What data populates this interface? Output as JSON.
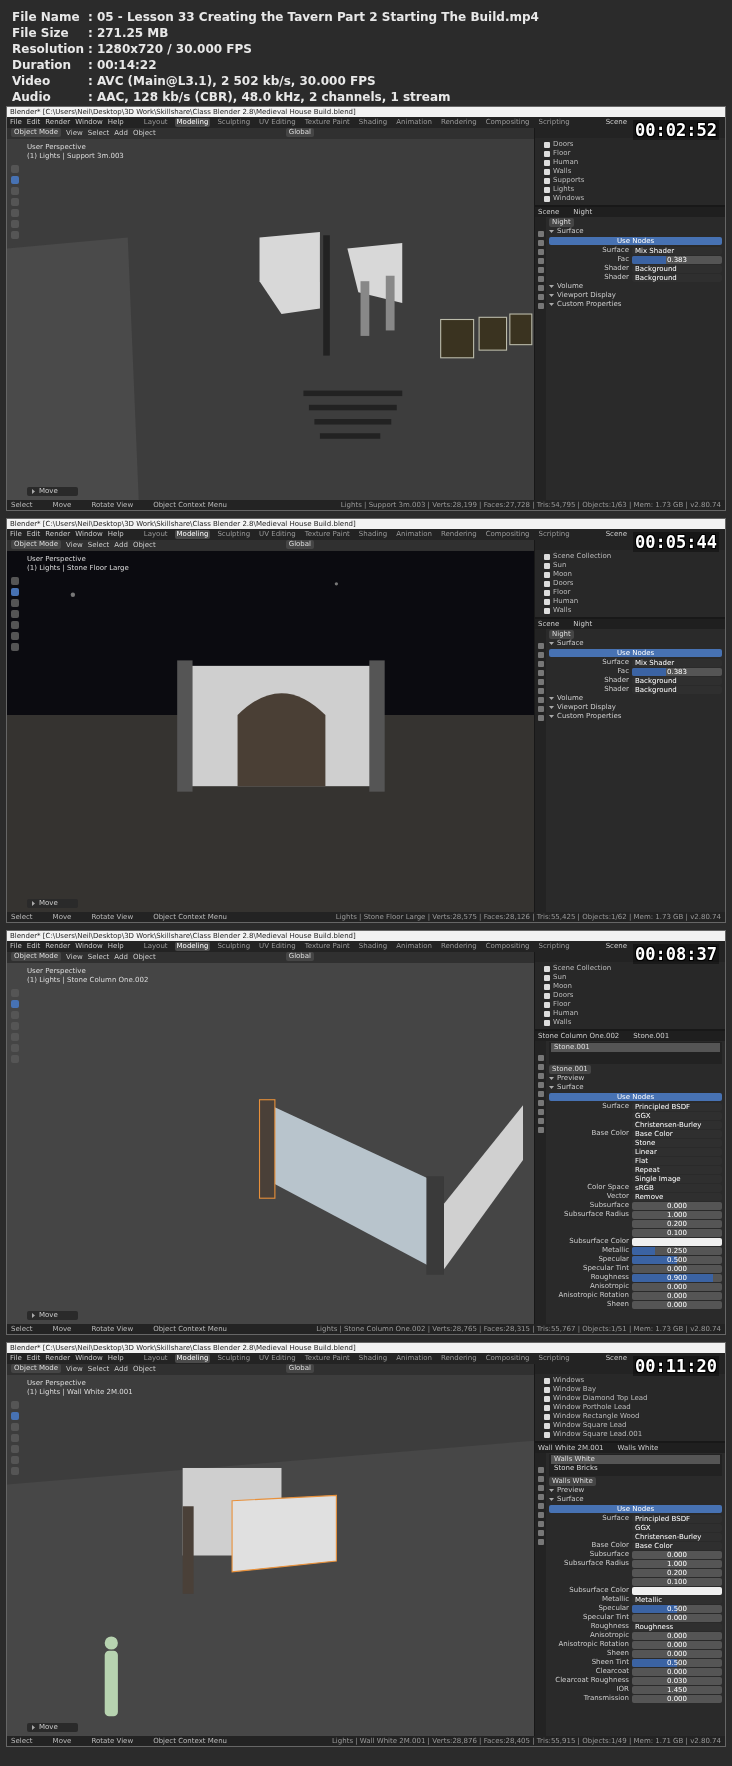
{
  "info": [
    {
      "label": "File Name",
      "sep": ":",
      "value": "05 - Lesson 33 Creating the Tavern Part 2 Starting The Build.mp4"
    },
    {
      "label": "File Size",
      "sep": ":",
      "value": "271.25 MB"
    },
    {
      "label": "Resolution",
      "sep": ":",
      "value": "1280x720 / 30.000 FPS"
    },
    {
      "label": "Duration",
      "sep": ":",
      "value": "00:14:22"
    },
    {
      "label": "Video",
      "sep": ":",
      "value": "AVC (Main@L3.1), 2 502 kb/s, 30.000 FPS"
    },
    {
      "label": "Audio",
      "sep": ":",
      "value": "AAC, 128 kb/s (CBR), 48.0 kHz, 2 channels, 1 stream"
    }
  ],
  "frames": [
    {
      "timestamp": "00:02:52",
      "title": "Blender* [C:\\Users\\Neil\\Desktop\\3D Work\\Skillshare\\Class Blender 2.8\\Medieval House Build.blend]",
      "menu": [
        "File",
        "Edit",
        "Render",
        "Window",
        "Help"
      ],
      "workspaces": [
        {
          "label": "Layout",
          "selected": false
        },
        {
          "label": "Modeling",
          "selected": true
        },
        {
          "label": "Sculpting",
          "selected": false
        },
        {
          "label": "UV Editing",
          "selected": false
        },
        {
          "label": "Texture Paint",
          "selected": false
        },
        {
          "label": "Shading",
          "selected": false
        },
        {
          "label": "Animation",
          "selected": false
        },
        {
          "label": "Rendering",
          "selected": false
        },
        {
          "label": "Compositing",
          "selected": false
        },
        {
          "label": "Scripting",
          "selected": false
        }
      ],
      "scene_name": "Scene",
      "mode": "Object Mode",
      "header_menu": [
        "View",
        "Select",
        "Add",
        "Object"
      ],
      "orientation": "Global",
      "view_name": "User Perspective",
      "object_info": "(1) Lights | Support 3m.003",
      "operator": "Move",
      "outliner": [
        {
          "label": "Doors",
          "checked": true
        },
        {
          "label": "Floor",
          "checked": true
        },
        {
          "label": "Human",
          "checked": true
        },
        {
          "label": "Walls",
          "checked": true
        },
        {
          "label": "Supports",
          "checked": true
        },
        {
          "label": "Lights",
          "checked": true
        },
        {
          "label": "Windows",
          "checked": true
        }
      ],
      "context": [
        "Scene",
        "Night"
      ],
      "datablock": "Night",
      "props": [
        {
          "kind": "section",
          "label": "Surface"
        },
        {
          "kind": "button",
          "label": "Use Nodes"
        },
        {
          "kind": "dropdown",
          "label": "Surface",
          "value": "Mix Shader"
        },
        {
          "kind": "slider",
          "label": "Fac",
          "value": "0.383",
          "level": 0.383
        },
        {
          "kind": "dropdown",
          "label": "Shader",
          "value": "Background"
        },
        {
          "kind": "dropdown",
          "label": "Shader",
          "value": "Background"
        },
        {
          "kind": "section",
          "label": "Volume"
        },
        {
          "kind": "section",
          "label": "Viewport Display"
        },
        {
          "kind": "section",
          "label": "Custom Properties"
        }
      ],
      "status": [
        "Select",
        "Move",
        "Rotate View",
        "Object Context Menu"
      ],
      "stats": "Lights | Support 3m.003 | Verts:28,199 | Faces:27,728 | Tris:54,795 | Objects:1/63 | Mem: 1.73 GB | v2.80.74"
    },
    {
      "timestamp": "00:05:44",
      "title": "Blender* [C:\\Users\\Neil\\Desktop\\3D Work\\Skillshare\\Class Blender 2.8\\Medieval House Build.blend]",
      "menu": [
        "File",
        "Edit",
        "Render",
        "Window",
        "Help"
      ],
      "workspaces": [
        {
          "label": "Layout",
          "selected": false
        },
        {
          "label": "Modeling",
          "selected": true
        },
        {
          "label": "Sculpting",
          "selected": false
        },
        {
          "label": "UV Editing",
          "selected": false
        },
        {
          "label": "Texture Paint",
          "selected": false
        },
        {
          "label": "Shading",
          "selected": false
        },
        {
          "label": "Animation",
          "selected": false
        },
        {
          "label": "Rendering",
          "selected": false
        },
        {
          "label": "Compositing",
          "selected": false
        },
        {
          "label": "Scripting",
          "selected": false
        }
      ],
      "scene_name": "Scene",
      "mode": "Object Mode",
      "header_menu": [
        "View",
        "Select",
        "Add",
        "Object"
      ],
      "orientation": "Global",
      "view_name": "User Perspective",
      "object_info": "(1) Lights | Stone Floor Large",
      "operator": "Move",
      "outliner": [
        {
          "label": "Scene Collection",
          "checked": true
        },
        {
          "label": "Sun",
          "checked": true
        },
        {
          "label": "Moon",
          "checked": true
        },
        {
          "label": "Doors",
          "checked": true
        },
        {
          "label": "Floor",
          "checked": true
        },
        {
          "label": "Human",
          "checked": true
        },
        {
          "label": "Walls",
          "checked": true
        }
      ],
      "context": [
        "Scene",
        "Night"
      ],
      "datablock": "Night",
      "props": [
        {
          "kind": "section",
          "label": "Surface"
        },
        {
          "kind": "button",
          "label": "Use Nodes"
        },
        {
          "kind": "dropdown",
          "label": "Surface",
          "value": "Mix Shader"
        },
        {
          "kind": "slider",
          "label": "Fac",
          "value": "0.383",
          "level": 0.383
        },
        {
          "kind": "dropdown",
          "label": "Shader",
          "value": "Background"
        },
        {
          "kind": "dropdown",
          "label": "Shader",
          "value": "Background"
        },
        {
          "kind": "section",
          "label": "Volume"
        },
        {
          "kind": "section",
          "label": "Viewport Display"
        },
        {
          "kind": "section",
          "label": "Custom Properties"
        }
      ],
      "status": [
        "Select",
        "Move",
        "Rotate View",
        "Object Context Menu"
      ],
      "stats": "Lights | Stone Floor Large | Verts:28,575 | Faces:28,126 | Tris:55,425 | Objects:1/62 | Mem: 1.73 GB | v2.80.74"
    },
    {
      "timestamp": "00:08:37",
      "title": "Blender* [C:\\Users\\Neil\\Desktop\\3D Work\\Skillshare\\Class Blender 2.8\\Medieval House Build.blend]",
      "menu": [
        "File",
        "Edit",
        "Render",
        "Window",
        "Help"
      ],
      "workspaces": [
        {
          "label": "Layout",
          "selected": false
        },
        {
          "label": "Modeling",
          "selected": true
        },
        {
          "label": "Sculpting",
          "selected": false
        },
        {
          "label": "UV Editing",
          "selected": false
        },
        {
          "label": "Texture Paint",
          "selected": false
        },
        {
          "label": "Shading",
          "selected": false
        },
        {
          "label": "Animation",
          "selected": false
        },
        {
          "label": "Rendering",
          "selected": false
        },
        {
          "label": "Compositing",
          "selected": false
        },
        {
          "label": "Scripting",
          "selected": false
        }
      ],
      "scene_name": "Scene",
      "mode": "Object Mode",
      "header_menu": [
        "View",
        "Select",
        "Add",
        "Object"
      ],
      "orientation": "Global",
      "view_name": "User Perspective",
      "object_info": "(1) Lights | Stone Column One.002",
      "operator": "Move",
      "outliner": [
        {
          "label": "Scene Collection",
          "checked": true
        },
        {
          "label": "Sun",
          "checked": true
        },
        {
          "label": "Moon",
          "checked": true
        },
        {
          "label": "Doors",
          "checked": true
        },
        {
          "label": "Floor",
          "checked": true
        },
        {
          "label": "Human",
          "checked": true
        },
        {
          "label": "Walls",
          "checked": true
        }
      ],
      "context": [
        "Stone Column One.002",
        "Stone.001"
      ],
      "slots": [
        "Stone.001"
      ],
      "datablock": "Stone.001",
      "props": [
        {
          "kind": "section",
          "label": "Preview"
        },
        {
          "kind": "section",
          "label": "Surface"
        },
        {
          "kind": "button",
          "label": "Use Nodes"
        },
        {
          "kind": "dropdown",
          "label": "Surface",
          "value": "Principled BSDF"
        },
        {
          "kind": "dropdown",
          "value": "GGX"
        },
        {
          "kind": "dropdown",
          "value": "Christensen-Burley"
        },
        {
          "kind": "dropdown",
          "label": "Base Color",
          "value": "Base Color"
        },
        {
          "kind": "dropdown",
          "value": "Stone"
        },
        {
          "kind": "dropdown",
          "value": "Linear"
        },
        {
          "kind": "dropdown",
          "value": "Flat"
        },
        {
          "kind": "dropdown",
          "value": "Repeat"
        },
        {
          "kind": "dropdown",
          "value": "Single Image"
        },
        {
          "kind": "dropdown",
          "label": "Color Space",
          "value": "sRGB"
        },
        {
          "kind": "dropdown",
          "label": "Vector",
          "value": "Remove"
        },
        {
          "kind": "value",
          "label": "Subsurface",
          "value": "0.000"
        },
        {
          "kind": "value",
          "label": "Subsurface Radius",
          "value": "1.000"
        },
        {
          "kind": "value",
          "value": "0.200"
        },
        {
          "kind": "value",
          "value": "0.100"
        },
        {
          "kind": "color",
          "label": "Subsurface Color"
        },
        {
          "kind": "slider",
          "label": "Metallic",
          "value": "0.250",
          "level": 0.25
        },
        {
          "kind": "slider",
          "label": "Specular",
          "value": "0.500",
          "level": 0.5
        },
        {
          "kind": "value",
          "label": "Specular Tint",
          "value": "0.000"
        },
        {
          "kind": "slider",
          "label": "Roughness",
          "value": "0.900",
          "level": 0.9
        },
        {
          "kind": "value",
          "label": "Anisotropic",
          "value": "0.000"
        },
        {
          "kind": "value",
          "label": "Anisotropic Rotation",
          "value": "0.000"
        },
        {
          "kind": "value",
          "label": "Sheen",
          "value": "0.000"
        }
      ],
      "status": [
        "Select",
        "Move",
        "Rotate View",
        "Object Context Menu"
      ],
      "stats": "Lights | Stone Column One.002 | Verts:28,765 | Faces:28,315 | Tris:55,767 | Objects:1/51 | Mem: 1.73 GB | v2.80.74"
    },
    {
      "timestamp": "00:11:20",
      "title": "Blender* [C:\\Users\\Neil\\Desktop\\3D Work\\Skillshare\\Class Blender 2.8\\Medieval House Build.blend]",
      "menu": [
        "File",
        "Edit",
        "Render",
        "Window",
        "Help"
      ],
      "workspaces": [
        {
          "label": "Layout",
          "selected": false
        },
        {
          "label": "Modeling",
          "selected": true
        },
        {
          "label": "Sculpting",
          "selected": false
        },
        {
          "label": "UV Editing",
          "selected": false
        },
        {
          "label": "Texture Paint",
          "selected": false
        },
        {
          "label": "Shading",
          "selected": false
        },
        {
          "label": "Animation",
          "selected": false
        },
        {
          "label": "Rendering",
          "selected": false
        },
        {
          "label": "Compositing",
          "selected": false
        },
        {
          "label": "Scripting",
          "selected": false
        }
      ],
      "scene_name": "Scene",
      "mode": "Object Mode",
      "header_menu": [
        "View",
        "Select",
        "Add",
        "Object"
      ],
      "orientation": "Global",
      "view_name": "User Perspective",
      "object_info": "(1) Lights | Wall White 2M.001",
      "operator": "Move",
      "outliner": [
        {
          "label": "Windows",
          "checked": true
        },
        {
          "label": "Window Bay",
          "checked": true
        },
        {
          "label": "Window Diamond Top Lead",
          "checked": true
        },
        {
          "label": "Window Porthole Lead",
          "checked": true
        },
        {
          "label": "Window Rectangle Wood",
          "checked": true
        },
        {
          "label": "Window Square Lead",
          "checked": true
        },
        {
          "label": "Window Square Lead.001",
          "checked": true
        }
      ],
      "context": [
        "Wall White 2M.001",
        "Walls White"
      ],
      "slots": [
        "Walls White",
        "Stone Bricks"
      ],
      "datablock": "Walls White",
      "props": [
        {
          "kind": "section",
          "label": "Preview"
        },
        {
          "kind": "section",
          "label": "Surface"
        },
        {
          "kind": "button",
          "label": "Use Nodes"
        },
        {
          "kind": "dropdown",
          "label": "Surface",
          "value": "Principled BSDF"
        },
        {
          "kind": "dropdown",
          "value": "GGX"
        },
        {
          "kind": "dropdown",
          "value": "Christensen-Burley"
        },
        {
          "kind": "dropdown",
          "label": "Base Color",
          "value": "Base Color"
        },
        {
          "kind": "value",
          "label": "Subsurface",
          "value": "0.000"
        },
        {
          "kind": "value",
          "label": "Subsurface Radius",
          "value": "1.000"
        },
        {
          "kind": "value",
          "value": "0.200"
        },
        {
          "kind": "value",
          "value": "0.100"
        },
        {
          "kind": "color",
          "label": "Subsurface Color"
        },
        {
          "kind": "dropdown",
          "label": "Metallic",
          "value": "Metallic"
        },
        {
          "kind": "slider",
          "label": "Specular",
          "value": "0.500",
          "level": 0.5
        },
        {
          "kind": "value",
          "label": "Specular Tint",
          "value": "0.000"
        },
        {
          "kind": "dropdown",
          "label": "Roughness",
          "value": "Roughness"
        },
        {
          "kind": "value",
          "label": "Anisotropic",
          "value": "0.000"
        },
        {
          "kind": "value",
          "label": "Anisotropic Rotation",
          "value": "0.000"
        },
        {
          "kind": "value",
          "label": "Sheen",
          "value": "0.000"
        },
        {
          "kind": "slider",
          "label": "Sheen Tint",
          "value": "0.500",
          "level": 0.5
        },
        {
          "kind": "value",
          "label": "Clearcoat",
          "value": "0.000"
        },
        {
          "kind": "value",
          "label": "Clearcoat Roughness",
          "value": "0.030"
        },
        {
          "kind": "value",
          "label": "IOR",
          "value": "1.450"
        },
        {
          "kind": "value",
          "label": "Transmission",
          "value": "0.000"
        }
      ],
      "status": [
        "Select",
        "Move",
        "Rotate View",
        "Object Context Menu"
      ],
      "stats": "Lights | Wall White 2M.001 | Verts:28,876 | Faces:28,405 | Tris:55,915 | Objects:1/49 | Mem: 1.71 GB | v2.80.74"
    }
  ]
}
